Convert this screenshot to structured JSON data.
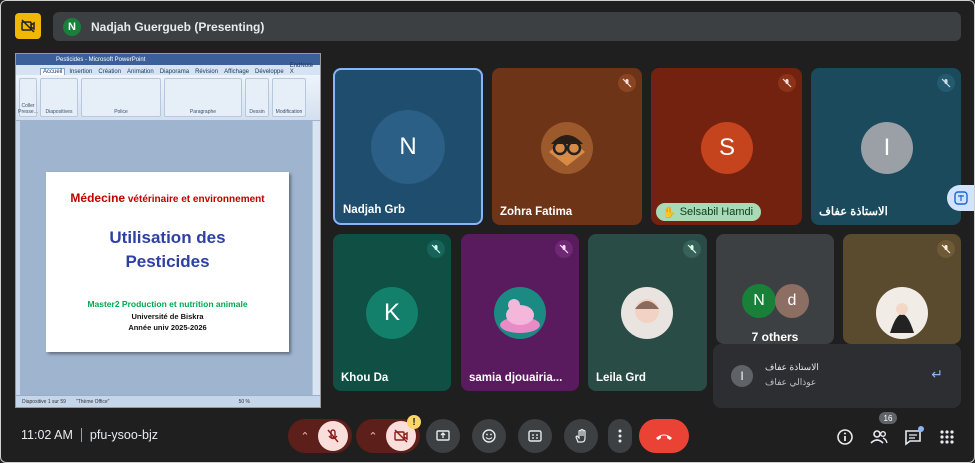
{
  "presenter": {
    "initial": "N",
    "label": "Nadjah Guergueb (Presenting)"
  },
  "presentation": {
    "window_title": "Pesticides - Microsoft PowerPoint",
    "tabs": [
      "Accueil",
      "Insertion",
      "Création",
      "Animation",
      "Diaporama",
      "Révision",
      "Affichage",
      "Développe",
      "EndNote X"
    ],
    "ribbon_groups": [
      "Presse...",
      "Police",
      "Paragraphe",
      "Dessin",
      "Modification"
    ],
    "ribbon_labels": {
      "paste": "Coller",
      "slides": "Diapositives"
    },
    "slide": {
      "heading_a": "Médecine",
      "heading_b": " vétérinaire et environnement",
      "title_1": "Utilisation des",
      "title_2": "Pesticides",
      "line1": "Master2 Production et nutrition animale",
      "line2": "Université de Biskra",
      "line3": "Année univ 2025-2026"
    },
    "status": {
      "slide_count": "Diapositive 1 sur 59",
      "theme": "\"Thème Office\"",
      "zoom": "50 %"
    }
  },
  "participants": [
    {
      "name": "Nadjah Grb",
      "initial": "N",
      "color": "#1a73e8"
    },
    {
      "name": "Zohra Fatima",
      "muted": true
    },
    {
      "name": "Selsabil Hamdi",
      "initial": "S",
      "color": "#c5441d",
      "muted": true,
      "hand_raised": true
    },
    {
      "name": "الاستاذة عفاف",
      "initial": "I",
      "color": "#9aa0a6",
      "muted": true
    },
    {
      "name": "Khou Da",
      "initial": "K",
      "color": "#12806a",
      "muted": true
    },
    {
      "name": "samia djouairia...",
      "muted": true
    },
    {
      "name": "Leila Grd",
      "muted": true
    },
    {
      "name": "7 others",
      "initials": [
        "N",
        "d"
      ]
    },
    {
      "name": "",
      "muted": true
    }
  ],
  "chat_popup": {
    "sender_initial": "I",
    "line1": "الاستاذة عفاف",
    "line2": "عوذالي عفاف"
  },
  "bottom_bar": {
    "time": "11:02 AM",
    "meeting_code": "pfu-ysoo-bjz",
    "people_count": "16",
    "cam_warning": "!"
  },
  "colors": {
    "danger": "#ea4335",
    "muted_bg": "#f9dedc",
    "accent": "#8ab4f8"
  }
}
